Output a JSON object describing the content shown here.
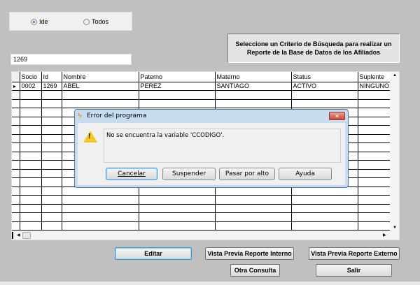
{
  "search": {
    "options": [
      {
        "label": "Ide",
        "selected": true
      },
      {
        "label": "Todos",
        "selected": false
      }
    ],
    "value": "1269"
  },
  "info_label": "Seleccione un Criterio de Búsqueda para realizar un Reporte de la Base de Datos de los Afiliados",
  "grid": {
    "columns": [
      "Socio",
      "Id",
      "Nombre",
      "Paterno",
      "Materno",
      "Status",
      "Suplente"
    ],
    "rows": [
      [
        "0002",
        "1269",
        "ABEL",
        "PEREZ",
        "SANTIAGO",
        "ACTIVO",
        "NINGUNO"
      ]
    ]
  },
  "dialog": {
    "title": "Error del programa",
    "message": "No se encuentra la variable 'CCODIGO'.",
    "buttons": {
      "cancel": "Cancelar",
      "suspend": "Suspender",
      "ignore": "Pasar por alto",
      "help": "Ayuda"
    },
    "close": "✕"
  },
  "buttons": {
    "edit": "Editar",
    "preview_internal": "Vista Previa Reporte Interno",
    "preview_external": "Vista Previa Reporte Externo",
    "new_query": "Otra Consulta",
    "exit": "Salir"
  }
}
